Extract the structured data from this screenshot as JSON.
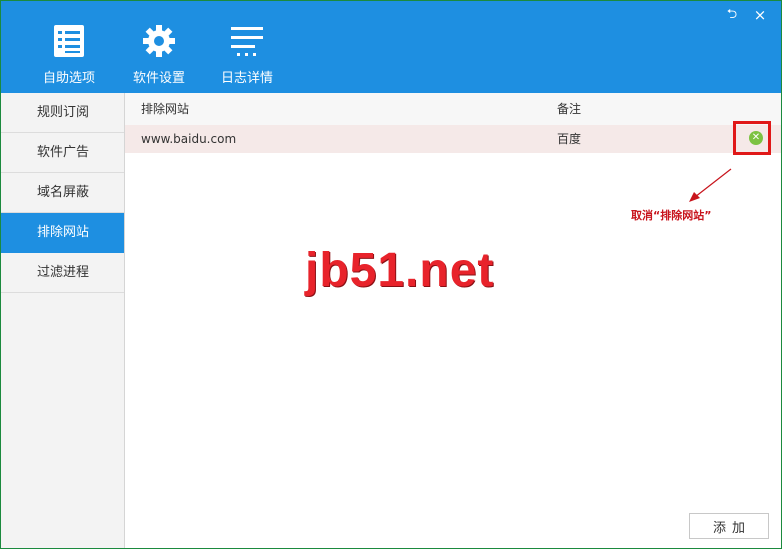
{
  "toolbar": {
    "items": [
      {
        "label": "自助选项",
        "icon": "checklist-icon"
      },
      {
        "label": "软件设置",
        "icon": "gear-icon"
      },
      {
        "label": "日志详情",
        "icon": "menu-lines-icon"
      }
    ]
  },
  "window_controls": {
    "restore": "⮌",
    "close": "×"
  },
  "sidebar": {
    "items": [
      {
        "label": "规则订阅",
        "active": false
      },
      {
        "label": "软件广告",
        "active": false
      },
      {
        "label": "域名屏蔽",
        "active": false
      },
      {
        "label": "排除网站",
        "active": true
      },
      {
        "label": "过滤进程",
        "active": false
      }
    ]
  },
  "table": {
    "columns": [
      "排除网站",
      "备注"
    ],
    "rows": [
      {
        "site": "www.baidu.com",
        "note": "百度"
      }
    ]
  },
  "annotation": "取消“排除网站”",
  "watermark": "jb51.net",
  "add_button": "添加",
  "colors": {
    "header": "#1e8fe1",
    "active_nav": "#1e8fe1",
    "highlight": "#e01818",
    "remove": "#7cc242",
    "row": "#f5e9e8"
  }
}
